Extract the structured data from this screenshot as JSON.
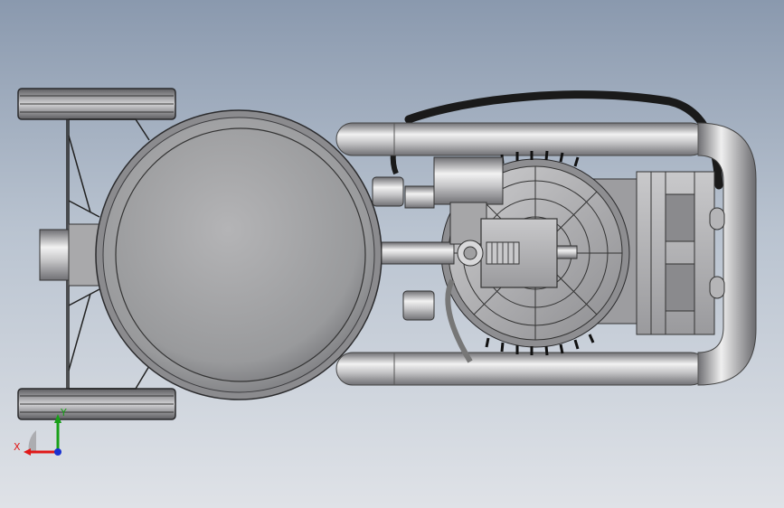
{
  "viewport": {
    "background_top": "#8a99ae",
    "background_bottom": "#dfe2e7"
  },
  "model": {
    "parts": [
      "air-tank",
      "frame-tube",
      "front-wheel",
      "rear-wheel",
      "hose",
      "motor-fan-shroud",
      "pressure-switch-block",
      "pressure-gauge",
      "cylinder-head",
      "handle-grip"
    ]
  },
  "triad": {
    "x_label": "X",
    "y_label": "Y",
    "x_color": "#e01818",
    "y_color": "#18a018",
    "z_color": "#1830d0"
  }
}
